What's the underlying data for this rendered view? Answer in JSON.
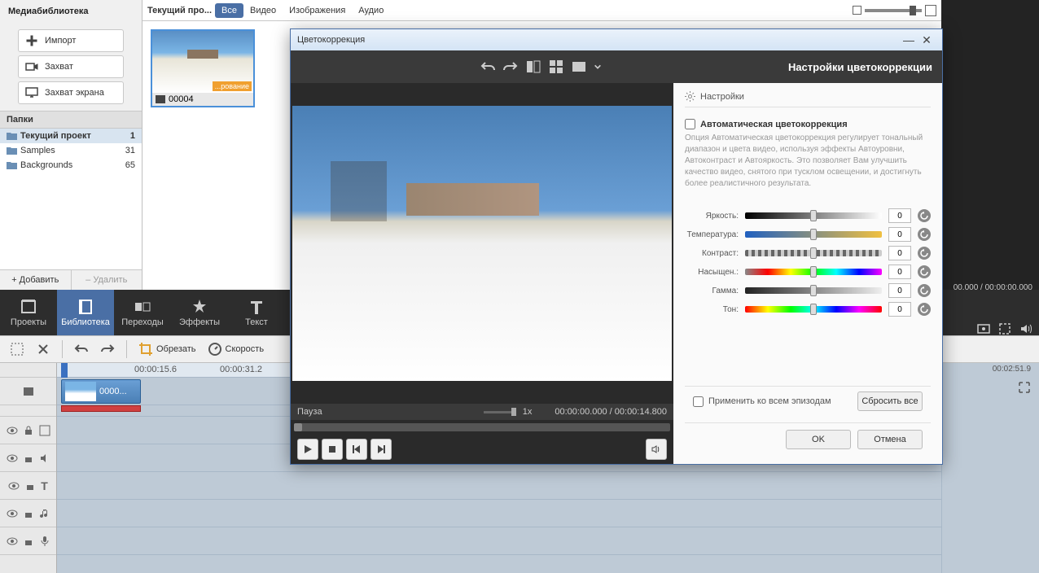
{
  "library": {
    "title": "Медиабиблиотека",
    "import": "Импорт",
    "capture": "Захват",
    "screen": "Захват экрана",
    "folders_hdr": "Папки",
    "add": "+ Добавить",
    "del": "– Удалить"
  },
  "folders": [
    {
      "name": "Текущий проект",
      "count": "1",
      "sel": true
    },
    {
      "name": "Samples",
      "count": "31",
      "sel": false
    },
    {
      "name": "Backgrounds",
      "count": "65",
      "sel": false
    }
  ],
  "mid": {
    "crumb": "Текущий про...",
    "tabs": [
      "Все",
      "Видео",
      "Изображения",
      "Аудио"
    ],
    "thumb_badge": "...рование",
    "thumb_name": "00004"
  },
  "modules": [
    {
      "id": "projects",
      "label": "Проекты"
    },
    {
      "id": "library",
      "label": "Библиотека"
    },
    {
      "id": "transitions",
      "label": "Переходы"
    },
    {
      "id": "effects",
      "label": "Эффекты"
    },
    {
      "id": "text",
      "label": "Текст"
    }
  ],
  "tlTools": {
    "crop": "Обрезать",
    "speed": "Скорость"
  },
  "ruler": {
    "t1": "00:00:15.6",
    "t2": "00:00:31.2",
    "tr": "00:02:51.9"
  },
  "clip": "0000...",
  "rt": {
    "time": "00.000 / 00:00:00.000"
  },
  "dlg": {
    "title": "Цветокоррекция",
    "bar_title": "Настройки цветокоррекции",
    "settings": "Настройки",
    "auto_label": "Автоматическая цветокоррекция",
    "auto_desc": "Опция Автоматическая цветокоррекция регулирует тональный диапазон и цвета видео, используя эффекты Автоуровни, Автоконтраст и Автояркость. Это позволяет Вам улучшить качество видео, снятого при тусклом освещении, и достигнуть более реалистичного результата.",
    "sliders": [
      {
        "label": "Яркость:",
        "cls": "br",
        "val": "0"
      },
      {
        "label": "Температура:",
        "cls": "tmp",
        "val": "0"
      },
      {
        "label": "Контраст:",
        "cls": "cn",
        "val": "0"
      },
      {
        "label": "Насыщен.:",
        "cls": "sat",
        "val": "0"
      },
      {
        "label": "Гамма:",
        "cls": "gm",
        "val": "0"
      },
      {
        "label": "Тон:",
        "cls": "hue",
        "val": "0"
      }
    ],
    "apply_all": "Применить ко всем эпизодам",
    "reset_all": "Сбросить все",
    "ok": "OK",
    "cancel": "Отмена",
    "status": "Пауза",
    "speed": "1x",
    "time": "00:00:00.000 / 00:00:14.800"
  }
}
